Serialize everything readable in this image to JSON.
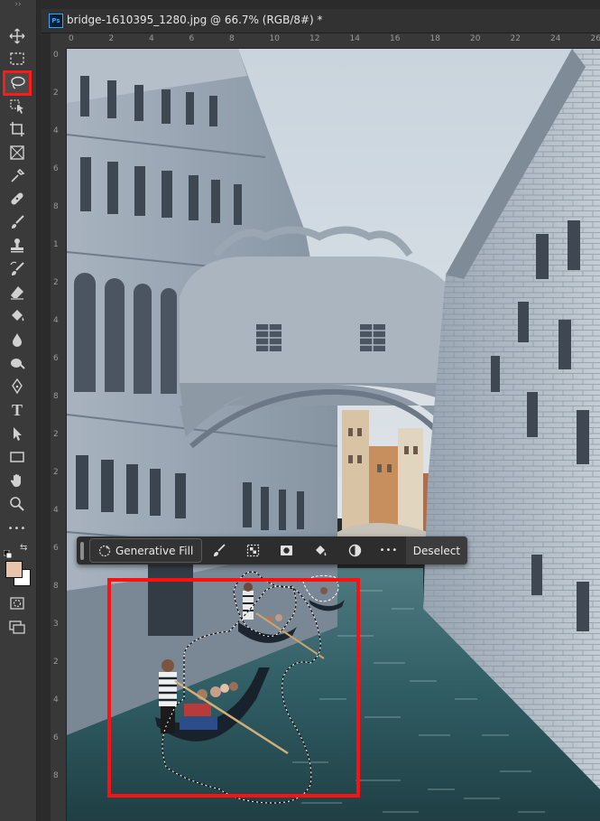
{
  "toolbar": {
    "grip": "›› ",
    "tools": [
      {
        "name": "move-tool",
        "icon": "move-icon"
      },
      {
        "name": "marquee-tool",
        "icon": "marquee-icon"
      },
      {
        "name": "lasso-tool",
        "icon": "lasso-icon",
        "selected": true
      },
      {
        "name": "object-selection-tool",
        "icon": "object-selection-icon"
      },
      {
        "name": "crop-tool",
        "icon": "crop-icon"
      },
      {
        "name": "frame-tool",
        "icon": "frame-icon"
      },
      {
        "name": "eyedropper-tool",
        "icon": "eyedropper-icon"
      },
      {
        "name": "healing-brush-tool",
        "icon": "bandage-icon"
      },
      {
        "name": "brush-tool",
        "icon": "brush-icon"
      },
      {
        "name": "clone-stamp-tool",
        "icon": "stamp-icon"
      },
      {
        "name": "history-brush-tool",
        "icon": "history-brush-icon"
      },
      {
        "name": "eraser-tool",
        "icon": "eraser-icon"
      },
      {
        "name": "paint-bucket-tool",
        "icon": "paint-bucket-icon"
      },
      {
        "name": "blur-tool",
        "icon": "drop-icon"
      },
      {
        "name": "dodge-tool",
        "icon": "dodge-icon"
      },
      {
        "name": "pen-tool",
        "icon": "pen-icon"
      },
      {
        "name": "type-tool",
        "icon": "type-icon",
        "label": "T"
      },
      {
        "name": "path-selection-tool",
        "icon": "arrow-icon"
      },
      {
        "name": "rectangle-tool",
        "icon": "rectangle-icon"
      },
      {
        "name": "hand-tool",
        "icon": "hand-icon"
      },
      {
        "name": "zoom-tool",
        "icon": "zoom-icon"
      },
      {
        "name": "more-tools",
        "icon": "ellipsis-icon",
        "label": "•••"
      }
    ],
    "foreground_color": "#e9c4ad",
    "background_color": "#ffffff"
  },
  "document": {
    "app_icon": "Ps",
    "title": "bridge-1610395_1280.jpg @ 66.7% (RGB/8#) *",
    "close": "✕"
  },
  "rulers": {
    "top": [
      "0",
      "2",
      "4",
      "6",
      "8",
      "10",
      "12",
      "14",
      "16",
      "18",
      "20",
      "22",
      "24",
      "26"
    ],
    "left": [
      "0",
      "2",
      "4",
      "6",
      "8",
      "1",
      "2",
      "4",
      "6",
      "8",
      "2",
      "2",
      "4",
      "6",
      "8",
      "3",
      "2",
      "4",
      "6",
      "8"
    ]
  },
  "taskbar": {
    "generative_fill": "Generative Fill",
    "deselect": "Deselect",
    "more": "•••"
  },
  "accent": {
    "highlight": "#ff1010"
  }
}
